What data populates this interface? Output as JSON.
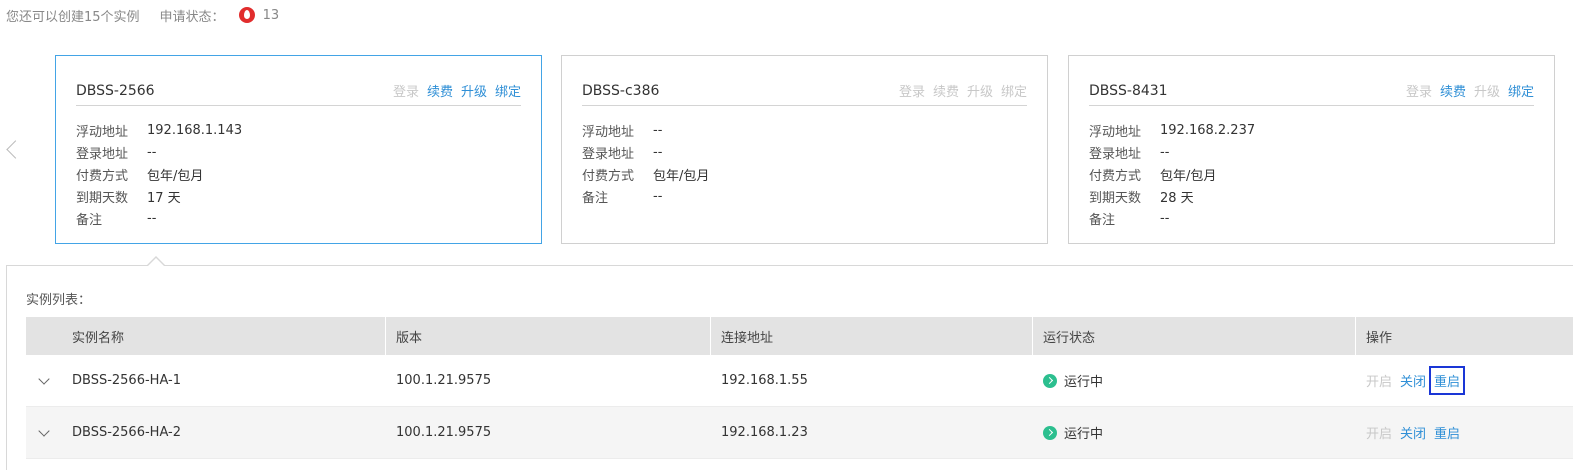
{
  "header": {
    "quota_text": "您还可以创建15个实例",
    "apply_label": "申请状态：",
    "apply_count": "13",
    "apply_icon": "fire-icon"
  },
  "colors": {
    "accent": "#2f8fd6",
    "active_border": "#43a4e6",
    "disabled_text": "#c8c8c8",
    "status_running": "#2cbf8f",
    "apply_icon": "#e12d2d",
    "highlight_box": "#1a36d6"
  },
  "cards": [
    {
      "title": "DBSS-2566",
      "actions": {
        "login": "登录",
        "renew": "续费",
        "upgrade": "升级",
        "bind": "绑定"
      },
      "actions_enabled": {
        "login": false,
        "renew": true,
        "upgrade": true,
        "bind": true
      },
      "fields": [
        {
          "label": "浮动地址",
          "value": "192.168.1.143"
        },
        {
          "label": "登录地址",
          "value": "--"
        },
        {
          "label": "付费方式",
          "value": "包年/包月"
        },
        {
          "label": "到期天数",
          "value": "17 天"
        },
        {
          "label": "备注",
          "value": "--"
        }
      ]
    },
    {
      "title": "DBSS-c386",
      "actions": {
        "login": "登录",
        "renew": "续费",
        "upgrade": "升级",
        "bind": "绑定"
      },
      "actions_enabled": {
        "login": false,
        "renew": false,
        "upgrade": false,
        "bind": false
      },
      "fields": [
        {
          "label": "浮动地址",
          "value": "--"
        },
        {
          "label": "登录地址",
          "value": "--"
        },
        {
          "label": "付费方式",
          "value": "包年/包月"
        },
        {
          "label": "备注",
          "value": "--"
        }
      ]
    },
    {
      "title": "DBSS-8431",
      "actions": {
        "login": "登录",
        "renew": "续费",
        "upgrade": "升级",
        "bind": "绑定"
      },
      "actions_enabled": {
        "login": false,
        "renew": true,
        "upgrade": false,
        "bind": true
      },
      "fields": [
        {
          "label": "浮动地址",
          "value": "192.168.2.237"
        },
        {
          "label": "登录地址",
          "value": "--"
        },
        {
          "label": "付费方式",
          "value": "包年/包月"
        },
        {
          "label": "到期天数",
          "value": "28 天"
        },
        {
          "label": "备注",
          "value": "--"
        }
      ]
    }
  ],
  "instance_list": {
    "title": "实例列表：",
    "columns": [
      "实例名称",
      "版本",
      "连接地址",
      "运行状态",
      "操作"
    ],
    "rows": [
      {
        "name": "DBSS-2566-HA-1",
        "version": "100.1.21.9575",
        "address": "192.168.1.55",
        "status": "运行中",
        "ops": {
          "start": "开启",
          "stop": "关闭",
          "restart": "重启"
        }
      },
      {
        "name": "DBSS-2566-HA-2",
        "version": "100.1.21.9575",
        "address": "192.168.1.23",
        "status": "运行中",
        "ops": {
          "start": "开启",
          "stop": "关闭",
          "restart": "重启"
        }
      }
    ]
  }
}
